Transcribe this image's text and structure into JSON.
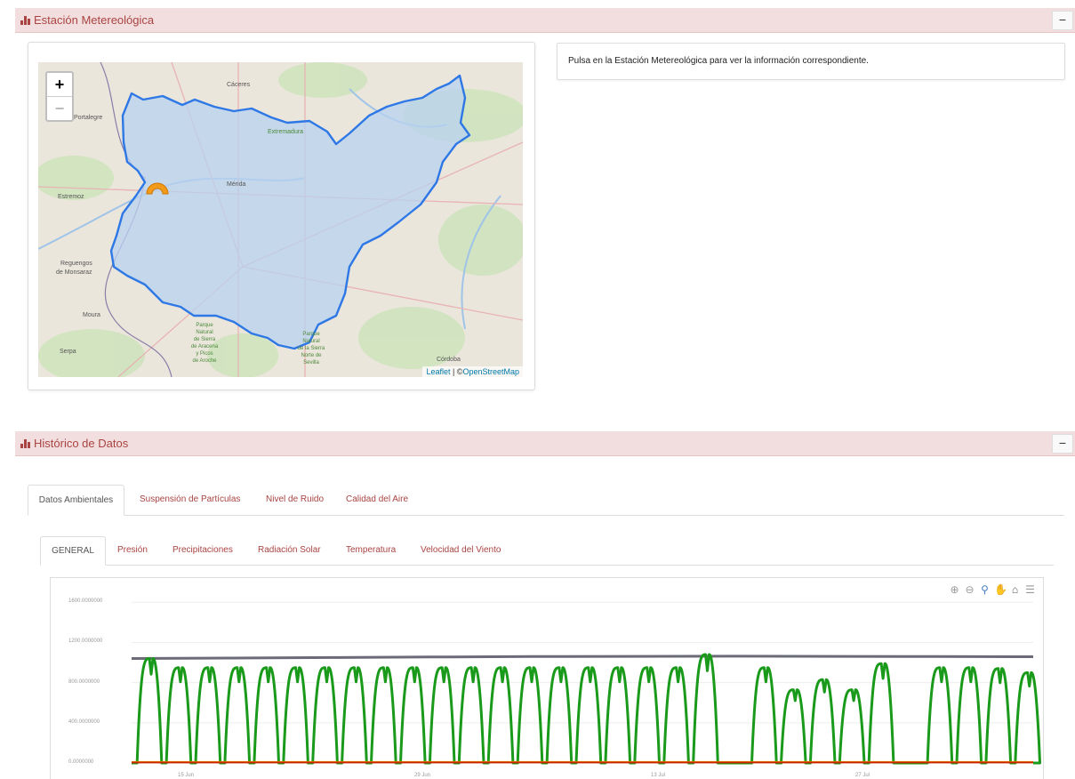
{
  "estacion_panel": {
    "title": "Estación Metereológica",
    "collapse_label": "−"
  },
  "map": {
    "zoom_in": "+",
    "zoom_out": "−",
    "attribution_leaflet": "Leaflet",
    "attribution_sep": " | ©",
    "attribution_osm": "OpenStreetMap",
    "places": {
      "caceres": "Cáceres",
      "portalegre": "Portalegre",
      "extremadura": "Extremadura",
      "estremoz": "Estremoz",
      "merida": "Mérida",
      "reguengos": "Reguengos",
      "de_monsaraz": "de Monsaraz",
      "moura": "Moura",
      "serpa": "Serpa",
      "parque_aracena_1": "Parque",
      "parque_aracena_2": "Natural",
      "parque_aracena_3": "de Sierra",
      "parque_aracena_4": "de Aracena",
      "parque_aracena_5": "y Picos",
      "parque_aracena_6": "de Aroche",
      "parque_norte_1": "Parque",
      "parque_norte_2": "Natural",
      "parque_norte_3": "de la Sierra",
      "parque_norte_4": "Norte de",
      "parque_norte_5": "Sevilla",
      "cordoba": "Córdoba"
    }
  },
  "info_text": "Pulsa en la Estación Metereológica para ver la información correspondiente.",
  "historico_panel": {
    "title": "Histórico de Datos",
    "collapse_label": "−"
  },
  "tabs_main": [
    "Datos Ambientales",
    "Suspensión de Partículas",
    "Nivel de Ruido",
    "Calidad del Aire"
  ],
  "tabs_sub": [
    "GENERAL",
    "Presión",
    "Precipitaciones",
    "Radiación Solar",
    "Temperatura",
    "Velocidad del Viento"
  ],
  "toolbar_icons": [
    "zoom-in-icon",
    "zoom-out-icon",
    "magnifier-icon",
    "pan-hand-icon",
    "home-icon",
    "menu-icon"
  ],
  "colors": {
    "header_bg": "#f2dede",
    "header_text": "#a94442",
    "series_green": "#1a9a1a",
    "series_gray": "#6b6b78",
    "series_red": "#cc2200",
    "series_yellow": "#f2c200",
    "region_fill": "#b8d2f0",
    "region_stroke": "#2e78e6"
  },
  "chart_data": {
    "type": "line",
    "y_ticks": [
      "1600.0000000",
      "1200.0000000",
      "800.0000000",
      "400.0000000",
      "0.0000000"
    ],
    "ylim": [
      0,
      1700
    ],
    "x_ticks": [
      "15 Jun",
      "29 Jun",
      "13 Jul",
      "27 Jul"
    ],
    "series": [
      {
        "color": "series_gray",
        "values": [
          1040,
          1045,
          1050,
          1055,
          1060,
          1062,
          1063,
          1062,
          1060,
          1058
        ]
      },
      {
        "color": "series_yellow",
        "values": [
          10,
          10,
          10,
          10,
          10,
          10,
          10,
          10,
          10,
          10
        ]
      },
      {
        "color": "series_red",
        "values": [
          5,
          5,
          5,
          5,
          5,
          5,
          5,
          5,
          5,
          5
        ]
      },
      {
        "color": "series_green",
        "peaks": [
          1040,
          950,
          950,
          950,
          950,
          950,
          950,
          950,
          950,
          950,
          950,
          950,
          950,
          950,
          950,
          950,
          950,
          950,
          950,
          1080,
          0,
          950,
          730,
          830,
          730,
          990,
          0,
          950,
          950,
          940,
          900
        ]
      }
    ],
    "grid": true
  }
}
